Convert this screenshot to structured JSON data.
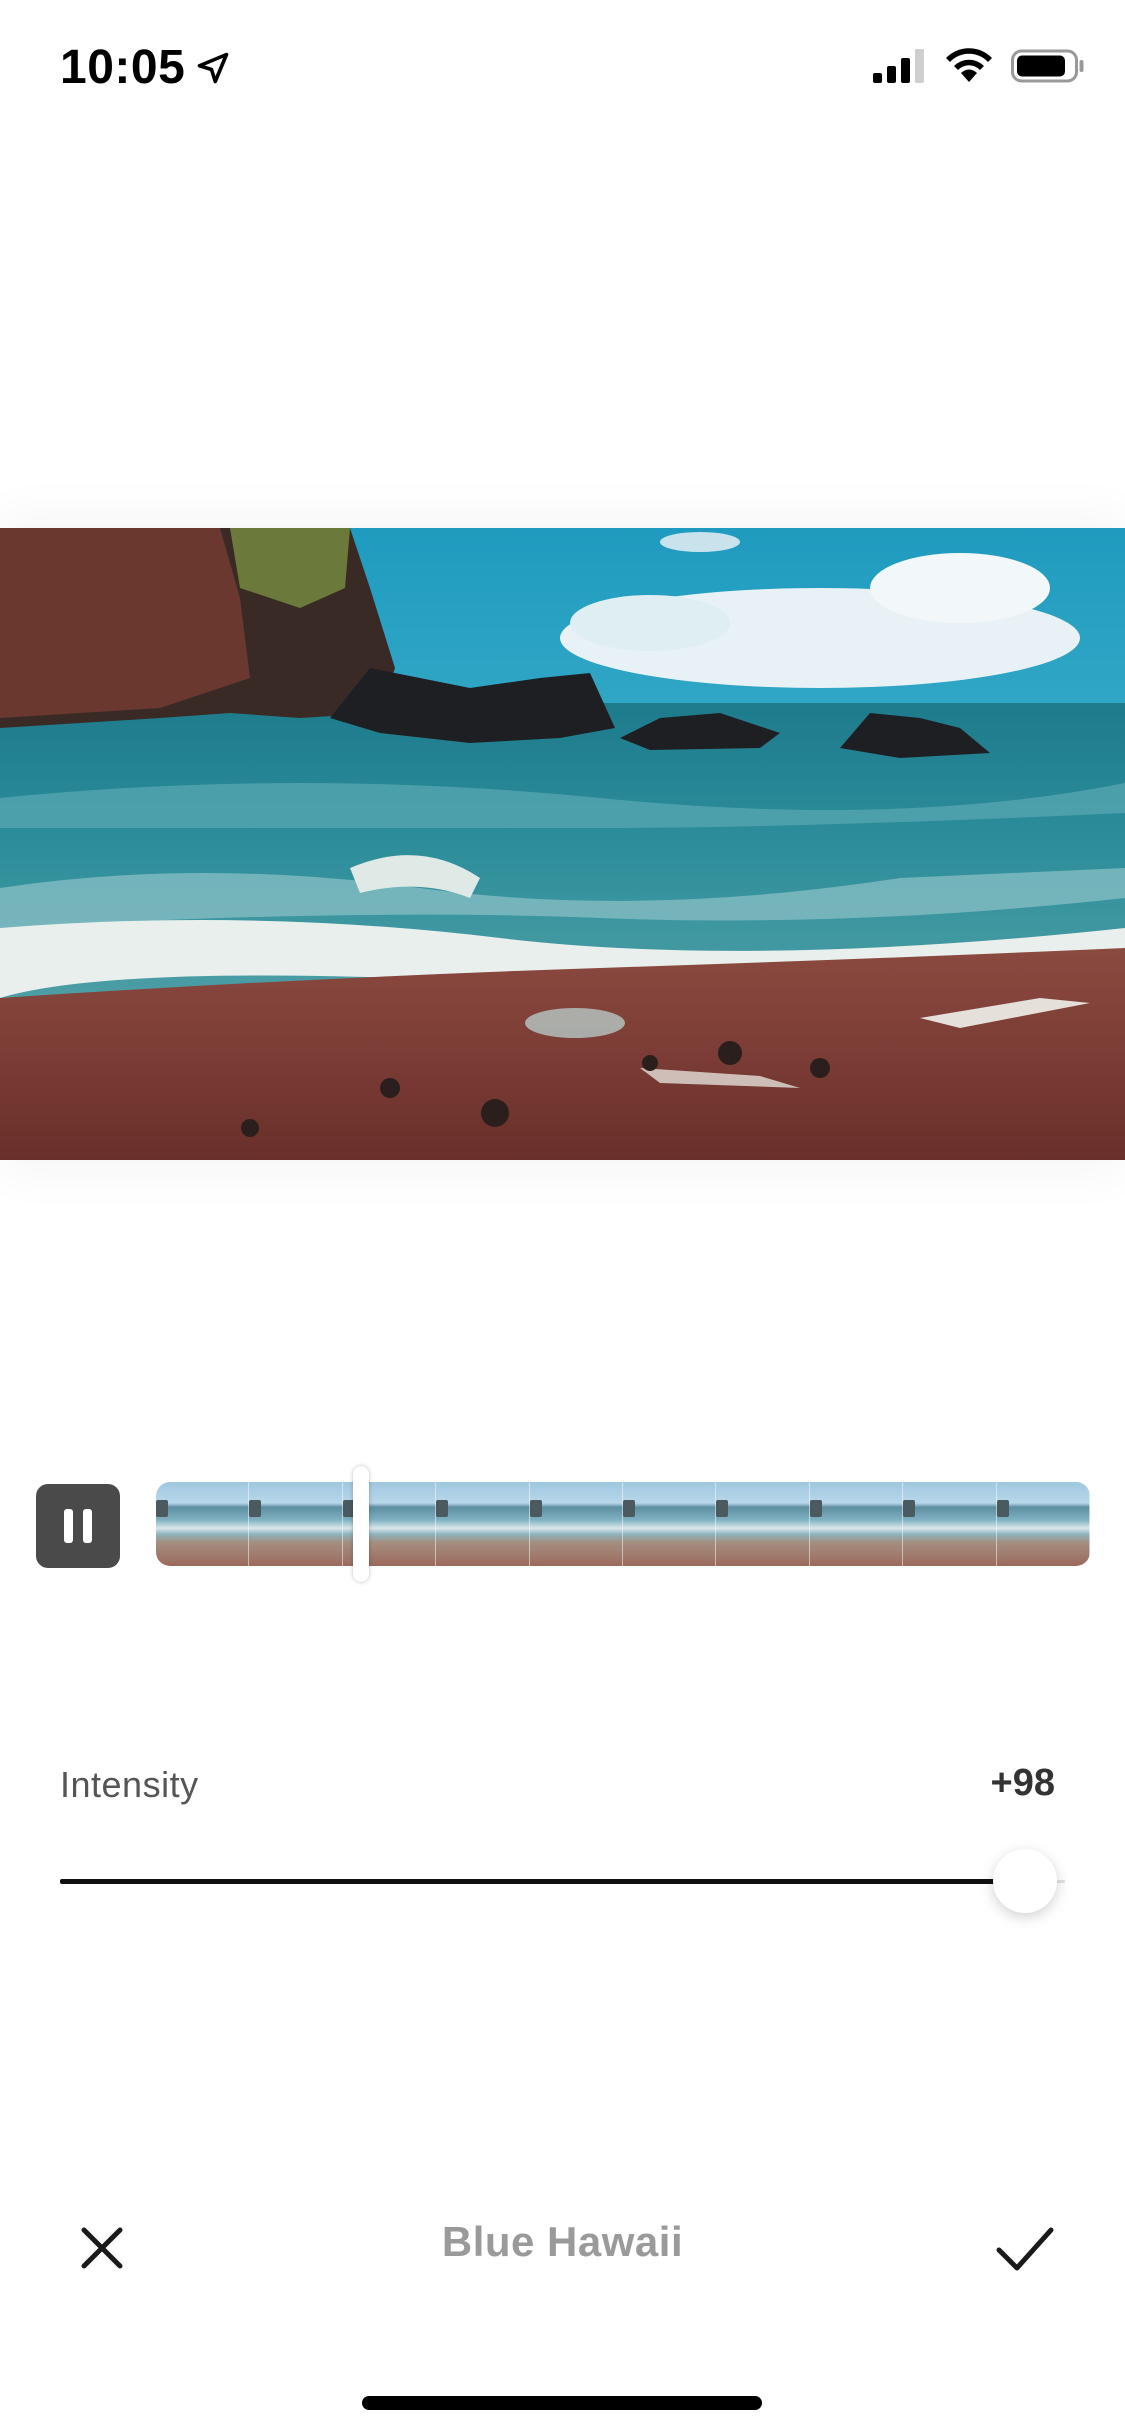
{
  "status_bar": {
    "time": "10:05",
    "location_icon": "location-arrow-icon",
    "signal_icon": "cellular-signal-icon",
    "wifi_icon": "wifi-icon",
    "battery_icon": "battery-icon"
  },
  "preview": {
    "scene": "beach-waves-image"
  },
  "playback": {
    "pause_icon": "pause-icon",
    "frame_count": 10,
    "playhead_fraction": 0.22
  },
  "intensity": {
    "label": "Intensity",
    "value": "+98",
    "level": 0.98
  },
  "bottom_bar": {
    "cancel_icon": "close-icon",
    "filter_name": "Blue Hawaii",
    "confirm_icon": "checkmark-icon"
  },
  "colors": {
    "accent": "#111111",
    "pause_bg": "#4a4a4a",
    "filter_name": "#9a9a9a"
  }
}
